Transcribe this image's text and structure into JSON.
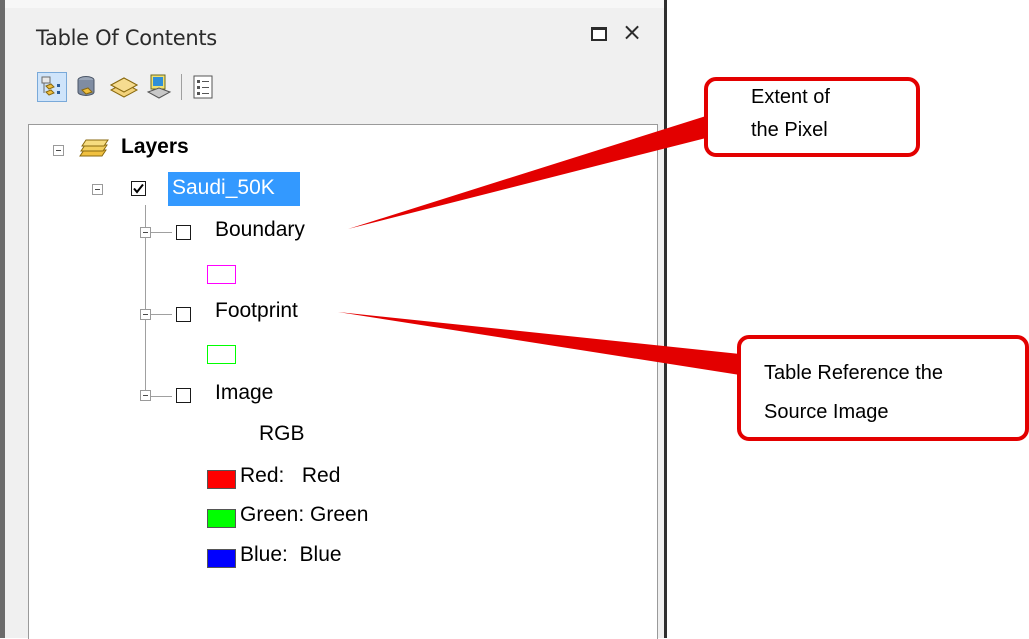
{
  "panel": {
    "title": "Table Of Contents",
    "restore_icon": "restore-window-icon",
    "close_label": "×"
  },
  "toolbar": {
    "buttons": [
      {
        "icon": "list-by-drawing-order-icon",
        "active": true
      },
      {
        "icon": "list-by-source-icon",
        "active": false
      },
      {
        "icon": "list-by-visibility-icon",
        "active": false
      },
      {
        "icon": "list-by-selection-icon",
        "active": false
      },
      {
        "icon": "options-icon",
        "active": false
      }
    ]
  },
  "tree": {
    "root": {
      "label": "Layers",
      "icon": "layers-icon"
    },
    "group": {
      "label": "Saudi_50K",
      "checked": true,
      "selected": true
    },
    "layers": [
      {
        "label": "Boundary",
        "checked": false,
        "symbol_color": "#ff00ff"
      },
      {
        "label": "Footprint",
        "checked": false,
        "symbol_color": "#00ff00"
      },
      {
        "label": "Image",
        "checked": false,
        "renderer": "RGB",
        "bands": [
          {
            "label": "Red:   Red",
            "color": "#ff0000"
          },
          {
            "label": "Green: Green",
            "color": "#00ff00"
          },
          {
            "label": "Blue:  Blue",
            "color": "#0000ff"
          }
        ]
      }
    ]
  },
  "callouts": [
    {
      "lines": [
        "Extent of",
        "the Pixel"
      ]
    },
    {
      "lines": [
        "Table Reference the",
        "Source Image"
      ]
    }
  ],
  "colors": {
    "callout": "#e30000",
    "selection": "#3399ff"
  }
}
